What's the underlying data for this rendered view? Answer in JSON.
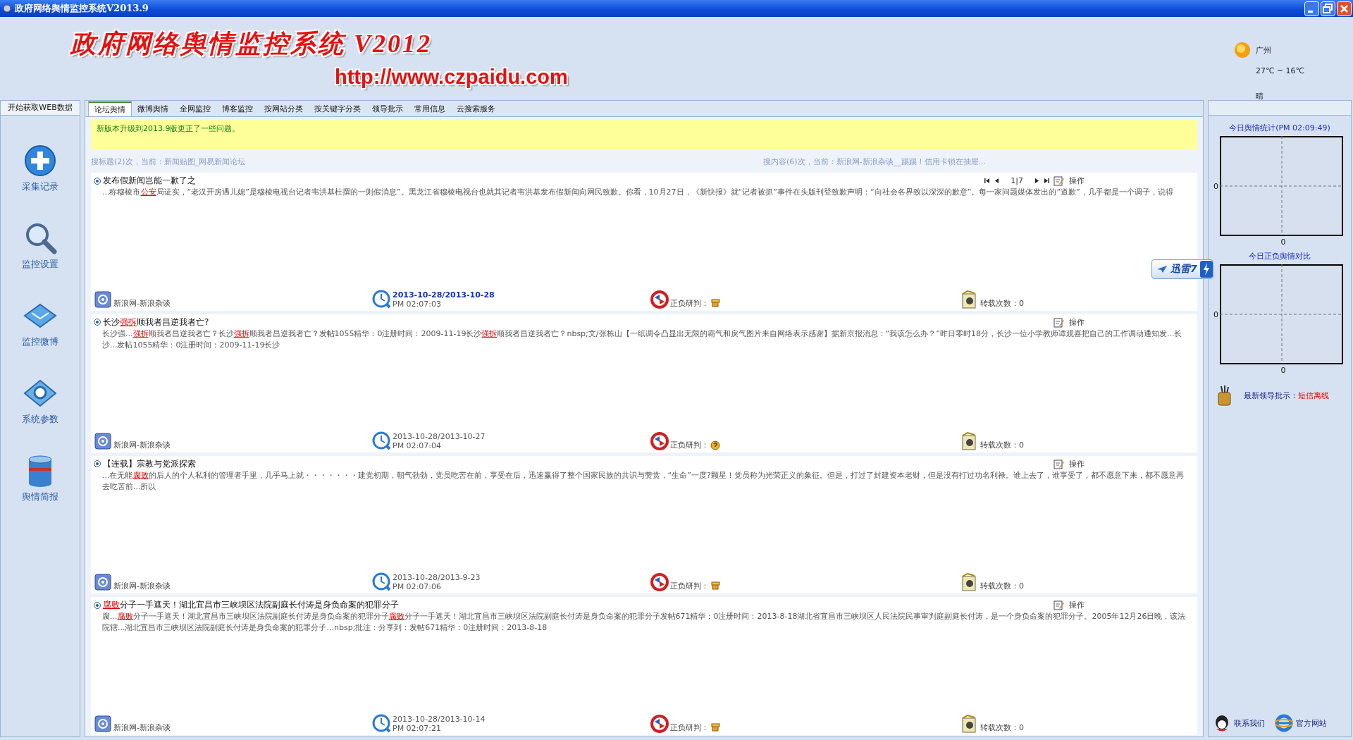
{
  "window": {
    "title": "政府网络舆情监控系统V2013.9"
  },
  "header": {
    "logo": "政府网络舆情监控系统 V2012",
    "url": "http://www.czpaidu.com"
  },
  "weather": {
    "city": "广州",
    "temperature": "27℃ ~ 16℃",
    "condition": "晴"
  },
  "sidebar": {
    "tab": "开始获取WEB数据",
    "items": [
      {
        "label": "采集记录",
        "kind": "add"
      },
      {
        "label": "监控设置",
        "kind": "search"
      },
      {
        "label": "监控微博",
        "kind": "mail"
      },
      {
        "label": "系统参数",
        "kind": "gear"
      },
      {
        "label": "舆情简报",
        "kind": "database"
      }
    ]
  },
  "tabs": [
    {
      "label": "论坛舆情",
      "selected": true
    },
    {
      "label": "微博舆情",
      "selected": false
    },
    {
      "label": "全网监控",
      "selected": false
    },
    {
      "label": "博客监控",
      "selected": false
    },
    {
      "label": "按网站分类",
      "selected": false
    },
    {
      "label": "按关键字分类",
      "selected": false
    },
    {
      "label": "领导批示",
      "selected": false
    },
    {
      "label": "常用信息",
      "selected": false
    },
    {
      "label": "云搜索服务",
      "selected": false
    }
  ],
  "notice": "新版本升级到2013.9版更正了一些问题。",
  "search_status": {
    "title_search": "搜标题(2)次，当前：新闻贴图_网易新闻论坛",
    "content_search": "搜内容(6)次，当前：新浪网-新浪杂谈__踢踢！信用卡锁在抽屉..."
  },
  "posts": [
    {
      "title": [
        {
          "text": "发布假新闻岂能一歉了之",
          "highlight": false
        }
      ],
      "pager": {
        "page": "1|7"
      },
      "action": "操作",
      "body": [
        {
          "text": "...称穆棱市",
          "highlight": false
        },
        {
          "text": "公安",
          "highlight": true
        },
        {
          "text": "局证实，“老汉开房遇儿媳”是穆棱电视台记者韦洪基杜撰的一则假消息”。黑龙江省穆棱电视台也就其记者韦洪基发布假新闻向网民致歉。你看，10月27日，《新快报》就“记者被抓”事件在头版刊登致歉声明：“向社会各界致以深深的歉意”。每一家问题媒体发出的“道歉”，几乎都是一个调子，说得",
          "highlight": false
        }
      ],
      "source": "新浪网-新浪杂谈",
      "date": "2013-10-28/2013-10-28",
      "date_highlight": true,
      "time": "PM 02:07:03",
      "judgment": {
        "label": "正负研判：",
        "kind": "hand"
      },
      "reposts": "转载次数：0"
    },
    {
      "title": [
        {
          "text": "长沙",
          "highlight": false
        },
        {
          "text": "强拆",
          "highlight": true
        },
        {
          "text": "顺我者昌逆我者亡?",
          "highlight": false
        }
      ],
      "action": "操作",
      "body": [
        {
          "text": "长沙强...",
          "highlight": false
        },
        {
          "text": "强拆",
          "highlight": true
        },
        {
          "text": "顺我者昌逆我者亡？长沙",
          "highlight": false
        },
        {
          "text": "强拆",
          "highlight": true
        },
        {
          "text": "顺我者昌逆我者亡？发帖1055精华：0注册时间：2009-11-19长沙",
          "highlight": false
        },
        {
          "text": "强拆",
          "highlight": true
        },
        {
          "text": "顺我者昌逆我者亡？nbsp;文/张栋山【一纸调令凸显出无限的霸气和戾气图片来自网络表示感谢】据新京报消息：“我该怎么办？”昨日零时18分，长沙一位小学教师谭观喜把自己的工作调动通知发...长沙...发帖1055精华：0注册时间：2009-11-19长沙",
          "highlight": false
        }
      ],
      "source": "新浪网-新浪杂谈",
      "date": "2013-10-28/2013-10-27",
      "date_highlight": false,
      "time": "PM 02:07:04",
      "judgment": {
        "label": "正负研判：",
        "kind": "question"
      },
      "reposts": "转载次数：0"
    },
    {
      "title": [
        {
          "text": "【连载】宗教与党派探索",
          "highlight": false
        }
      ],
      "action": "操作",
      "body": [
        {
          "text": "...在无能",
          "highlight": false
        },
        {
          "text": "腐败",
          "highlight": true
        },
        {
          "text": "的后人的个人私利的管理者手里，几乎马上就・・・・・・・建党初期，朝气勃勃，党员吃苦在前，享受在后，迅速赢得了整个国家民族的共识与赞赏，“生命”一度?颗星！党员称为光荣正义的象征。但是，打过了封建资本老财，但是没有打过功名利禄。谁上去了，谁享受了，都不愿意下来，都不愿意再去吃苦前...所以",
          "highlight": false
        }
      ],
      "source": "新浪网-新浪杂谈",
      "date": "2013-10-28/2013-9-23",
      "date_highlight": false,
      "time": "PM 02:07:06",
      "judgment": {
        "label": "正负研判：",
        "kind": "hand"
      },
      "reposts": "转载次数：0"
    },
    {
      "title": [
        {
          "text": "腐败",
          "highlight": true
        },
        {
          "text": "分子一手遮天！湖北宜昌市三峡坝区法院副庭长付涛是身负命案的犯罪分子",
          "highlight": false
        }
      ],
      "action": "操作",
      "body": [
        {
          "text": "腐...",
          "highlight": false
        },
        {
          "text": "腐败",
          "highlight": true
        },
        {
          "text": "分子一手遮天！湖北宜昌市三峡坝区法院副庭长付涛是身负命案的犯罪分子",
          "highlight": false
        },
        {
          "text": "腐败",
          "highlight": true
        },
        {
          "text": "分子一手遮天！湖北宜昌市三峡坝区法院副庭长付涛是身负命案的犯罪分子发帖671精华：0注册时间：2013-8-18湖北省宜昌市三峡坝区人民法院民事审判庭副庭长付涛，是一个身负命案的犯罪分子。2005年12月26日晚，该法院辖...湖北宜昌市三峡坝区法院副庭长付涛是身负命案的犯罪分子...nbsp;批注：分享到：发帖671精华：0注册时间：2013-8-18",
          "highlight": false
        }
      ],
      "source": "新浪网-新浪杂谈",
      "date": "2013-10-28/2013-10-14",
      "date_highlight": false,
      "time": "PM 02:07:21",
      "judgment": {
        "label": "正负研判：",
        "kind": "hand"
      },
      "reposts": "转载次数：0"
    }
  ],
  "floating_badge": {
    "label": "迅雷7"
  },
  "right_panel": {
    "charts": [
      {
        "title": "今日舆情统计(PM 02:09:49)",
        "y_tick": "0",
        "x_tick": "0"
      },
      {
        "title": "今日正负舆情对比",
        "y_tick": "0",
        "x_tick": "0"
      }
    ],
    "instruction_label": "最新领导批示：",
    "instruction_status": "短信离线",
    "links": [
      {
        "label": "联系我们",
        "kind": "qq"
      },
      {
        "label": "官方网站",
        "kind": "ie"
      }
    ]
  }
}
